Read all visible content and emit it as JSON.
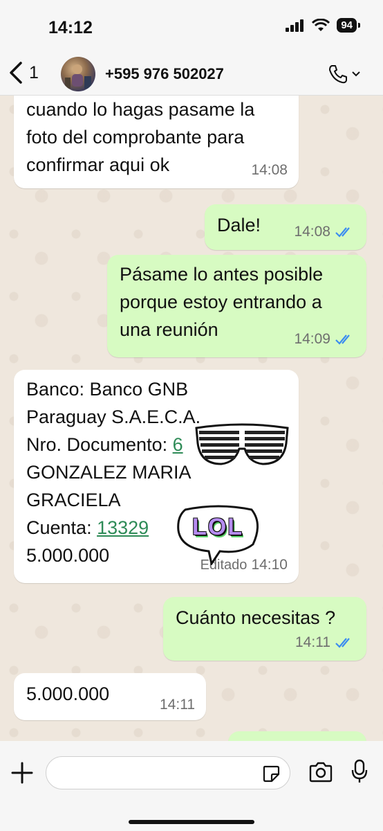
{
  "status_bar": {
    "time": "14:12",
    "battery": "94"
  },
  "header": {
    "back_count": "1",
    "contact": "+595 976 502027"
  },
  "messages": [
    {
      "lines": [
        "cuando lo hagas pasame la",
        "foto del comprobante para",
        "confirmar aqui ok"
      ],
      "time": "14:08"
    },
    {
      "text": "Dale!",
      "time": "14:08"
    },
    {
      "lines": [
        "Pásame lo antes posible",
        "porque estoy entrando a",
        "una reunión"
      ],
      "time": "14:09"
    },
    {
      "line1": "Banco: Banco GNB",
      "line2": "Paraguay S.A.E.C.A.",
      "line3_label": "Nro. Documento: ",
      "line3_link": "6",
      "line4": "GONZALEZ MARIA",
      "line5": "GRACIELA",
      "line6_label": "Cuenta: ",
      "line6_link": "13329",
      "line7": "5.000.000",
      "edited": "Editado",
      "time": "14:10"
    },
    {
      "text": "Cuánto necesitas ?",
      "time": "14:11"
    },
    {
      "text": "5.000.000",
      "time": "14:11"
    }
  ],
  "sticker": {
    "text": "LOL"
  },
  "colors": {
    "outgoing": "#d7fbc2",
    "incoming": "#ffffff",
    "read_ticks": "#3b8cf0",
    "link": "#2e8b57"
  }
}
